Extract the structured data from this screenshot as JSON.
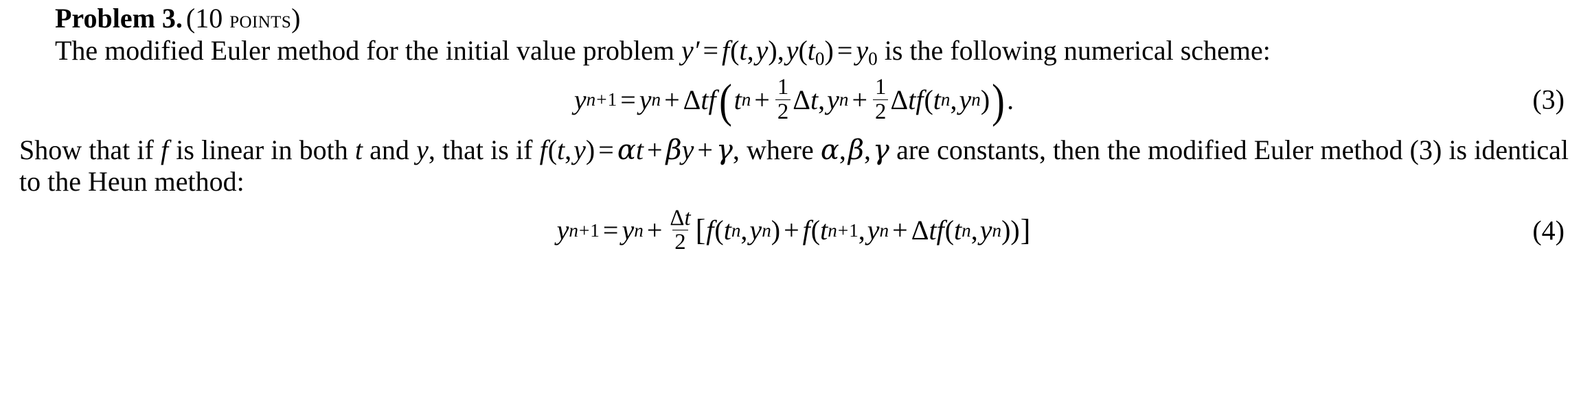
{
  "document": {
    "problem_label": "Problem 3.",
    "points_open": "(10 ",
    "points_word": "points",
    "points_close": ")",
    "paragraph1": {
      "text_a": "The modified Euler method for the initial value problem ",
      "math_y": "y",
      "math_prime": "′",
      "eq_sign": "=",
      "math_f": "f",
      "math_open": "(",
      "math_t": "t",
      "math_comma1": ",",
      "math_y2": "y",
      "math_close": ")",
      "math_comma2": ",",
      "math_y3": "y",
      "math_open2": "(",
      "math_t0_base": "t",
      "math_t0_sub": "0",
      "math_close2": ")",
      "eq_sign2": "=",
      "math_y0_base": "y",
      "math_y0_sub": "0",
      "text_b": " is the following",
      "text_c": "numerical scheme:"
    },
    "equation3": {
      "lhs_base": "y",
      "lhs_sub_n": "n",
      "lhs_sub_plus": "+",
      "lhs_sub_one": "1",
      "equals": "=",
      "y_base": "y",
      "y_sub": "n",
      "plus1": "+",
      "delta": "Δ",
      "t1": "t",
      "f1": "f",
      "paren_open": "(",
      "tn_base": "t",
      "tn_sub": "n",
      "plus2": "+",
      "frac1_num": "1",
      "frac1_den": "2",
      "delta2": "Δ",
      "t2": "t",
      "comma": ",",
      "yn_base": "y",
      "yn_sub": "n",
      "plus3": "+",
      "frac2_num": "1",
      "frac2_den": "2",
      "delta3": "Δ",
      "t3": "t",
      "f2": "f",
      "inner_open": "(",
      "inner_t_base": "t",
      "inner_t_sub": "n",
      "inner_comma": ",",
      "inner_y_base": "y",
      "inner_y_sub": "n",
      "inner_close": ")",
      "paren_close": ")",
      "period": ".",
      "number": "(3)"
    },
    "paragraph2": {
      "text_a": "Show that if ",
      "math_f1": "f",
      "text_b": " is linear in both ",
      "math_t": "t",
      "text_c": " and ",
      "math_y": "y",
      "text_d": ", that is if ",
      "math_f2": "f",
      "open": "(",
      "math_t2": "t",
      "comma1": ",",
      "math_y2": "y",
      "close": ")",
      "equals": "=",
      "alpha": "α",
      "math_t3": "t",
      "plus1": "+",
      "beta": "β",
      "math_y3": "y",
      "plus2": "+",
      "gamma": "γ",
      "text_e": ", where ",
      "alpha2": "α",
      "comma2": ",",
      "beta2": "β",
      "comma3": ",",
      "gamma2": "γ",
      "text_f": " are constants, then",
      "text_g": "the modified Euler method (3) is identical to the Heun method:"
    },
    "equation4": {
      "lhs_base": "y",
      "lhs_sub_n": "n",
      "lhs_sub_plus": "+",
      "lhs_sub_one": "1",
      "equals": "=",
      "y_base": "y",
      "y_sub": "n",
      "plus1": "+",
      "frac_num_delta": "Δ",
      "frac_num_t": "t",
      "frac_den": "2",
      "bracket_open": "[",
      "f1": "f",
      "open1": "(",
      "t1_base": "t",
      "t1_sub": "n",
      "comma1": ",",
      "y1_base": "y",
      "y1_sub": "n",
      "close1": ")",
      "plus2": "+",
      "f2": "f",
      "open2": "(",
      "t2_base": "t",
      "t2_sub_n": "n",
      "t2_sub_plus": "+",
      "t2_sub_one": "1",
      "comma2": ",",
      "y2_base": "y",
      "y2_sub": "n",
      "plus3": "+",
      "delta": "Δ",
      "t3": "t",
      "f3": "f",
      "open3": "(",
      "t4_base": "t",
      "t4_sub": "n",
      "comma3": ",",
      "y3_base": "y",
      "y3_sub": "n",
      "close3": ")",
      "close2": ")",
      "bracket_close": "]",
      "number": "(4)"
    }
  }
}
